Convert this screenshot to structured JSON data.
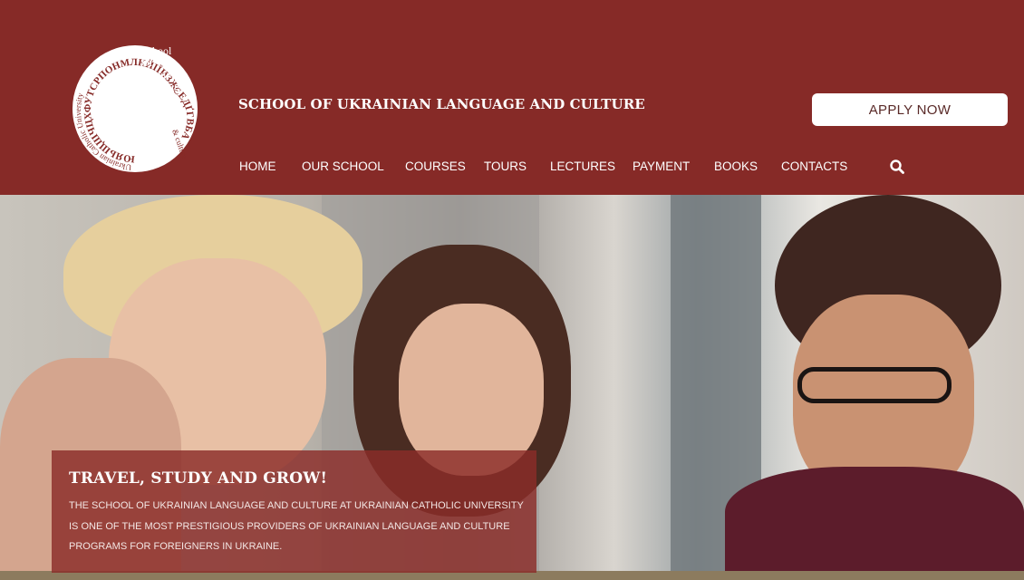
{
  "header": {
    "logo": {
      "lines": [
        "School",
        "Of",
        "Ukrainian",
        "Language"
      ],
      "ring_text": "Ukrainian Catholic University",
      "ring_text_2": "& culture",
      "spiral_text": "ЮЯЬЩШЧЦХФУТСРПОНМЛКЙІЇИЗЖЄЕДҐГВБА"
    },
    "title": "SCHOOL OF UKRAINIAN LANGUAGE AND CULTURE",
    "apply_label": "APPLY NOW",
    "nav": [
      "HOME",
      "OUR SCHOOL",
      "COURSES",
      "TOURS",
      "LECTURES",
      "PAYMENT",
      "BOOKS",
      "CONTACTS"
    ],
    "search_icon": "search-icon",
    "colors": {
      "brand": "#862a27",
      "button_text": "#5a2a28"
    }
  },
  "hero": {
    "title": "TRAVEL, STUDY AND GROW!",
    "lines": [
      "THE SCHOOL OF UKRAINIAN LANGUAGE AND CULTURE AT UKRAINIAN CATHOLIC UNIVERSITY",
      "IS ONE OF THE MOST PRESTIGIOUS PROVIDERS OF UKRAINIAN LANGUAGE AND CULTURE",
      "PROGRAMS FOR FOREIGNERS IN UKRAINE."
    ]
  }
}
